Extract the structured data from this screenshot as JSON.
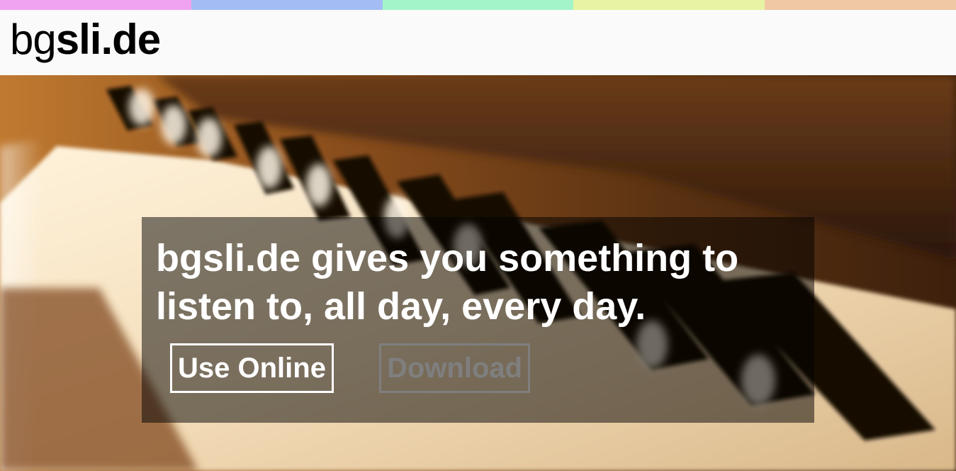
{
  "top_stripe_colors": [
    "#f0a3f0",
    "#a3bdf4",
    "#a3f4c8",
    "#e8f4a3",
    "#f0c8a3"
  ],
  "header": {
    "logo_light": "bg",
    "logo_bold": "sli.de"
  },
  "hero": {
    "image": "piano-keys-photo",
    "tagline": "bgsli.de gives you something to listen to, all day, every day.",
    "buttons": {
      "use_online_label": "Use Online",
      "download_label": "Download"
    },
    "colors": {
      "use_online": "#ffffff",
      "download_disabled": "#7f7f7f"
    }
  }
}
